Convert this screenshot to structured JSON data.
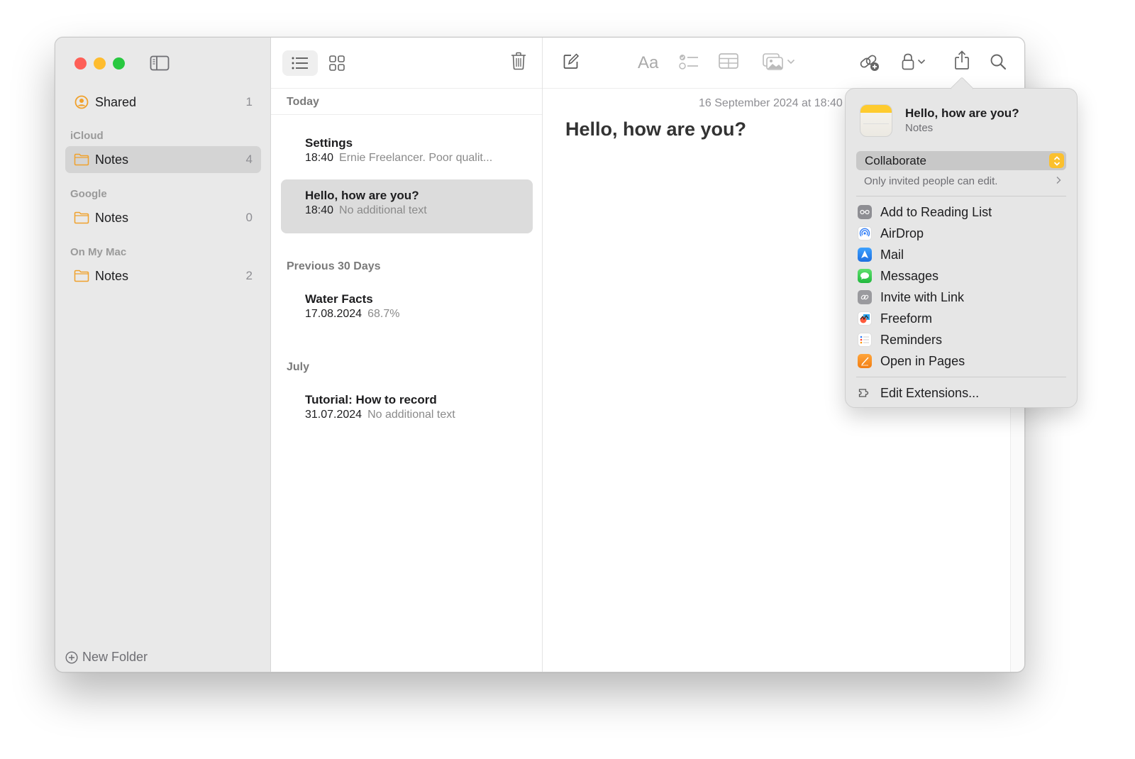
{
  "window": {
    "traffic_lights": [
      "close",
      "minimize",
      "zoom"
    ]
  },
  "sidebar": {
    "toggle_icon": "sidebar-toggle-icon",
    "shared": {
      "label": "Shared",
      "count": "1",
      "icon": "person-circle-icon"
    },
    "sections": [
      {
        "title": "iCloud",
        "folders": [
          {
            "label": "Notes",
            "count": "4",
            "selected": true
          }
        ]
      },
      {
        "title": "Google",
        "folders": [
          {
            "label": "Notes",
            "count": "0",
            "selected": false
          }
        ]
      },
      {
        "title": "On My Mac",
        "folders": [
          {
            "label": "Notes",
            "count": "2",
            "selected": false
          }
        ]
      }
    ],
    "new_folder_label": "New Folder"
  },
  "note_list": {
    "groups": [
      {
        "label": "Today",
        "notes": [
          {
            "title": "Settings",
            "date": "18:40",
            "snippet": "Ernie Freelancer. Poor qualit..."
          },
          {
            "title": "Hello, how are you?",
            "date": "18:40",
            "snippet": "No additional text",
            "selected": true
          }
        ]
      },
      {
        "label": "Previous 30 Days",
        "notes": [
          {
            "title": "Water Facts",
            "date": "17.08.2024",
            "snippet": "68.7%"
          }
        ]
      },
      {
        "label": "July",
        "notes": [
          {
            "title": "Tutorial: How to record",
            "date": "31.07.2024",
            "snippet": "No additional text"
          }
        ]
      }
    ]
  },
  "editor": {
    "date": "16 September 2024 at 18:40",
    "title": "Hello, how are you?",
    "toolbar": {
      "format_label": "Aa"
    }
  },
  "share_popover": {
    "note_title": "Hello, how are you?",
    "app_name": "Notes",
    "mode": "Collaborate",
    "permission_text": "Only invited people can edit.",
    "items": [
      {
        "label": "Add to Reading List",
        "icon": "reading-list-icon",
        "color": "#8e8e93"
      },
      {
        "label": "AirDrop",
        "icon": "airdrop-icon",
        "color": "#2f7cf6"
      },
      {
        "label": "Mail",
        "icon": "mail-icon",
        "color": "#1e88f5"
      },
      {
        "label": "Messages",
        "icon": "messages-icon",
        "color": "#34c759"
      },
      {
        "label": "Invite with Link",
        "icon": "link-icon",
        "color": "#9a9a9e"
      },
      {
        "label": "Freeform",
        "icon": "freeform-icon",
        "color": "#ff6f3c"
      },
      {
        "label": "Reminders",
        "icon": "reminders-icon",
        "color": "#ffffff"
      },
      {
        "label": "Open in Pages",
        "icon": "pages-icon",
        "color": "#f7941d"
      }
    ],
    "edit_extensions_label": "Edit Extensions..."
  }
}
